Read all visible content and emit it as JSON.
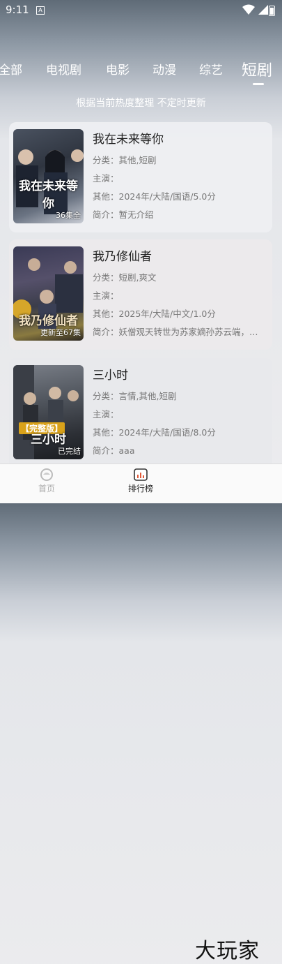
{
  "status": {
    "time": "9:11"
  },
  "tabs": [
    "全部",
    "电视剧",
    "电影",
    "动漫",
    "综艺",
    "短剧"
  ],
  "subtitle": "根据当前热度整理 不定时更新",
  "cards": [
    {
      "title": "我在未来等你",
      "category": "分类：其他,短剧",
      "cast": "主演：",
      "other": "其他：2024年/大陆/国语/5.0分",
      "intro": "简介：暂无介绍",
      "badge": "36集全",
      "poster_text": "我在未来等你"
    },
    {
      "title": "我乃修仙者",
      "category": "分类：短剧,爽文",
      "cast": "主演：",
      "other": "其他：2025年/大陆/中文/1.0分",
      "intro": "简介：妖僧观天转世为苏家嫡孙苏云端，…",
      "badge": "更新至67集",
      "poster_text": "我乃修仙者"
    },
    {
      "title": "三小时",
      "category": "分类：言情,其他,短剧",
      "cast": "主演：",
      "other": "其他：2024年/大陆/国语/8.0分",
      "intro": "简介：aaa",
      "badge": "已完结",
      "poster_text": "三小时",
      "poster_tag": "【完整版】"
    }
  ],
  "nav": {
    "home": "首页",
    "rank": "排行榜"
  },
  "watermark": "大玩家",
  "colors": {
    "accent": "#ffffff",
    "card_bg": "#eef0f3"
  }
}
